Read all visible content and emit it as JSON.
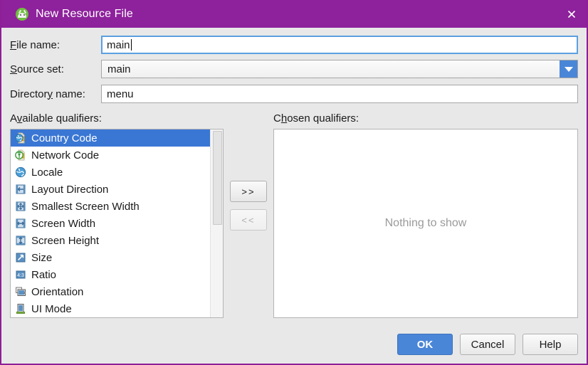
{
  "window": {
    "title": "New Resource File",
    "app_icon": "android-studio-icon",
    "close_icon": "close-icon",
    "accent_color": "#8e219c",
    "selection_color": "#3a77d4",
    "primary_button_color": "#4a86d8"
  },
  "form": {
    "file_name": {
      "label_pre": "F",
      "label_mnemonic": "",
      "label_post": "ile name:",
      "label": "File name:",
      "value": "main",
      "focused": true
    },
    "source_set": {
      "label": "Source set:",
      "value": "main",
      "dropdown_icon": "chevron-down-icon"
    },
    "directory_name": {
      "label": "Directory name:",
      "value": "menu"
    }
  },
  "available": {
    "title": "Available qualifiers:",
    "items": [
      {
        "label": "Country Code",
        "icon": "country-code-icon",
        "selected": true
      },
      {
        "label": "Network Code",
        "icon": "network-code-icon",
        "selected": false
      },
      {
        "label": "Locale",
        "icon": "locale-icon",
        "selected": false
      },
      {
        "label": "Layout Direction",
        "icon": "layout-direction-icon",
        "selected": false
      },
      {
        "label": "Smallest Screen Width",
        "icon": "smallest-screen-width-icon",
        "selected": false
      },
      {
        "label": "Screen Width",
        "icon": "screen-width-icon",
        "selected": false
      },
      {
        "label": "Screen Height",
        "icon": "screen-height-icon",
        "selected": false
      },
      {
        "label": "Size",
        "icon": "size-icon",
        "selected": false
      },
      {
        "label": "Ratio",
        "icon": "ratio-icon",
        "selected": false
      },
      {
        "label": "Orientation",
        "icon": "orientation-icon",
        "selected": false
      },
      {
        "label": "UI Mode",
        "icon": "ui-mode-icon",
        "selected": false
      }
    ]
  },
  "transfer": {
    "add_label": ">>",
    "remove_label": "<<",
    "add_enabled": true,
    "remove_enabled": false
  },
  "chosen": {
    "title": "Chosen qualifiers:",
    "empty_text": "Nothing to show",
    "items": []
  },
  "footer": {
    "ok_label": "OK",
    "cancel_label": "Cancel",
    "help_label": "Help"
  }
}
